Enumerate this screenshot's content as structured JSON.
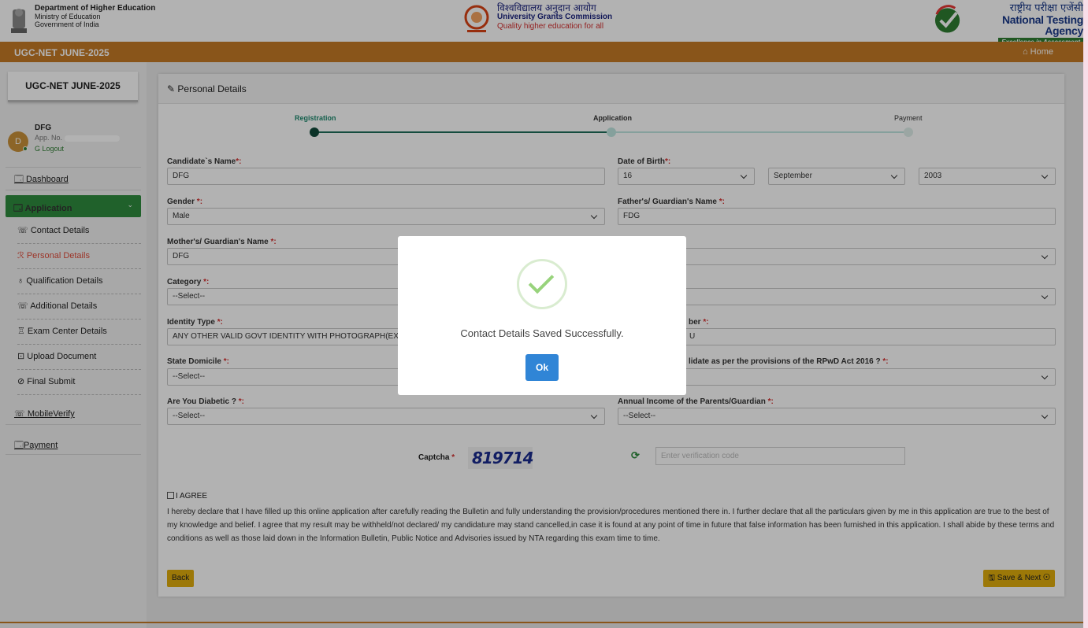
{
  "header": {
    "dept": {
      "line1": "Department of Higher Education",
      "line2": "Ministry of Education",
      "line3": "Government of India"
    },
    "ugc": {
      "hindi": "विश्वविद्यालय अनुदान आयोग",
      "name": "University Grants Commission",
      "tagline": "Quality higher education for all"
    },
    "nta": {
      "hindi": "राष्ट्रीय परीक्षा एजेंसी",
      "name": "National Testing Agency",
      "tagline": "Excellence in Assessment"
    }
  },
  "topnav": {
    "title": "UGC-NET JUNE-2025",
    "home": "⌂ Home"
  },
  "sidebar": {
    "exam_title": "UGC-NET JUNE-2025",
    "user": {
      "initial": "D",
      "name": "DFG",
      "app_no_label": "App. No.",
      "logout": "G Logout"
    },
    "dashboard": "Dashboard",
    "application": "Application",
    "items": [
      {
        "label": "Contact Details",
        "icon": "phone-icon"
      },
      {
        "label": "Personal Details",
        "icon": "person-icon"
      },
      {
        "label": "Qualification Details",
        "icon": "bulb-icon"
      },
      {
        "label": "Additional Details",
        "icon": "phone-icon"
      },
      {
        "label": "Exam Center Details",
        "icon": "building-icon"
      },
      {
        "label": "Upload Document",
        "icon": "upload-icon"
      },
      {
        "label": "Final Submit",
        "icon": "check-circle-icon"
      }
    ],
    "mobile_verify": "MobileVerify",
    "payment": "Payment"
  },
  "main": {
    "title": "Personal Details",
    "steps": [
      "Registration",
      "Application",
      "Payment"
    ],
    "fields": {
      "candidate_name": {
        "label": "Candidate`s Name",
        "value": "DFG"
      },
      "dob": {
        "label": "Date of Birth",
        "day": "16",
        "month": "September",
        "year": "2003"
      },
      "gender": {
        "label": "Gender ",
        "value": "Male"
      },
      "father": {
        "label": "Father's/ Guardian's Name ",
        "value": "FDG"
      },
      "mother": {
        "label": "Mother's/ Guardian's Name ",
        "value": "DFG"
      },
      "category": {
        "label": "Category ",
        "value": "--Select--"
      },
      "identity_type": {
        "label": "Identity Type ",
        "value": "ANY OTHER VALID GOVT IDENTITY WITH PHOTOGRAPH(EXCEP"
      },
      "identity_number": {
        "label": "ber ",
        "value": "U"
      },
      "state": {
        "label": "State Domicile ",
        "value": "--Select--"
      },
      "pwd": {
        "label": "lidate as per the provisions of the RPwD Act 2016 ? ",
        "value": ""
      },
      "diabetic": {
        "label": "Are You Diabetic ? ",
        "value": "--Select--"
      },
      "income": {
        "label": "Annual Income of the Parents/Guardian ",
        "value": "--Select--"
      },
      "right_row3": {
        "value": ""
      },
      "right_row4": {
        "value": ""
      }
    },
    "req_mark": "*:",
    "captcha": {
      "label": "Captcha",
      "req": "*",
      "code": "819714",
      "placeholder": "Enter verification code"
    },
    "agree": "I AGREE",
    "declaration": "I hereby declare that I have filled up this online application after carefully reading the Bulletin and fully understanding the provision/procedures mentioned there in. I further declare that all the particulars given by me in this application are true to the best of my knowledge and belief. I agree that my result may be withheld/not declared/ my candidature may stand cancelled,in case it is found at any point of time in future that false information has been furnished in this application. I shall abide by these terms and conditions as well as those laid down in the Information Bulletin, Public Notice and Advisories issued by NTA regarding this exam time to time.",
    "back": "Back",
    "save_next": "🖫 Save & Next ⊙"
  },
  "modal": {
    "message": "Contact Details Saved Successfully.",
    "ok": "Ok"
  },
  "colors": {
    "orange": "#c47a26",
    "green": "#2e8b3e",
    "active_red": "#e04b3a",
    "ok_blue": "#3085d6"
  }
}
